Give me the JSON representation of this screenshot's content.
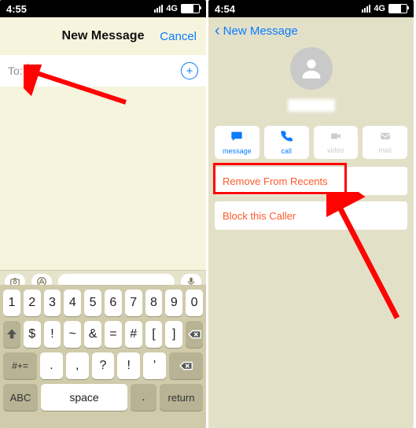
{
  "left": {
    "status": {
      "time": "4:55",
      "net": "4G"
    },
    "nav": {
      "title": "New Message",
      "cancel": "Cancel"
    },
    "to": {
      "label": "To:"
    },
    "keyboard": {
      "row1": [
        "1",
        "2",
        "3",
        "4",
        "5",
        "6",
        "7",
        "8",
        "9",
        "0"
      ],
      "row2": [
        "$",
        "!",
        "~",
        "&",
        "=",
        "#",
        "[",
        "]"
      ],
      "row3_left": "#+=",
      "row3": [
        ".",
        ",",
        "?",
        "!",
        "'"
      ],
      "row4": {
        "abc": "ABC",
        "space": "space",
        "ret": "return"
      }
    }
  },
  "right": {
    "status": {
      "time": "4:54",
      "net": "4G"
    },
    "nav": {
      "back": "New Message"
    },
    "actions": {
      "message": "message",
      "call": "call",
      "video": "video",
      "mail": "mail"
    },
    "remove": "Remove From Recents",
    "block": "Block this Caller"
  }
}
